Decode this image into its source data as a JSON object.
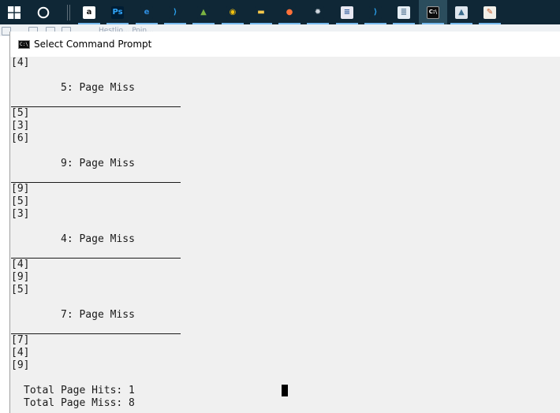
{
  "window": {
    "title": "Select Command Prompt"
  },
  "background": {
    "obscured_text": "Hestlio... Poin..."
  },
  "taskbar": {
    "apps": [
      {
        "name": "amazon",
        "glyph": "a",
        "color": "#ffffff",
        "fg": "#111111"
      },
      {
        "name": "photoshop",
        "glyph": "Ps",
        "color": "#001d34",
        "fg": "#31a8ff"
      },
      {
        "name": "edge",
        "glyph": "e",
        "color": "#0f2736",
        "fg": "#2f8ee0"
      },
      {
        "name": "vscode",
        "glyph": "⟩",
        "color": "#0f2736",
        "fg": "#2aa4f2"
      },
      {
        "name": "android-studio",
        "glyph": "▲",
        "color": "#0f2736",
        "fg": "#7cb342"
      },
      {
        "name": "chrome",
        "glyph": "◉",
        "color": "#0f2736",
        "fg": "#f4c20d"
      },
      {
        "name": "file-explorer",
        "glyph": "▬",
        "color": "#0f2736",
        "fg": "#f8c84a"
      },
      {
        "name": "firefox",
        "glyph": "●",
        "color": "#0f2736",
        "fg": "#ff7139"
      },
      {
        "name": "settings",
        "glyph": "✹",
        "color": "#0f2736",
        "fg": "#cfd6de"
      },
      {
        "name": "word-doc",
        "glyph": "≡",
        "color": "#e8e8f2",
        "fg": "#2b579a"
      },
      {
        "name": "vscode-2",
        "glyph": "⟩",
        "color": "#0f2736",
        "fg": "#2aa4f2"
      },
      {
        "name": "notepad",
        "glyph": "≣",
        "color": "#e6eef5",
        "fg": "#5a7a96"
      },
      {
        "name": "command-prompt",
        "glyph": "C:\\",
        "color": "#0c0c0c",
        "fg": "#ffffff",
        "active": true
      },
      {
        "name": "photos",
        "glyph": "▲",
        "color": "#dfe6ee",
        "fg": "#3c6d8e"
      },
      {
        "name": "paint",
        "glyph": "✎",
        "color": "#f1efe8",
        "fg": "#c85a2a"
      }
    ]
  },
  "console": {
    "sections": [
      {
        "type": "line",
        "text": "[4]"
      },
      {
        "type": "blank"
      },
      {
        "type": "header",
        "text": "5: Page Miss"
      },
      {
        "type": "sep"
      },
      {
        "type": "line",
        "text": "[5]"
      },
      {
        "type": "line",
        "text": "[3]"
      },
      {
        "type": "line",
        "text": "[6]"
      },
      {
        "type": "blank"
      },
      {
        "type": "header",
        "text": "9: Page Miss"
      },
      {
        "type": "sep"
      },
      {
        "type": "line",
        "text": "[9]"
      },
      {
        "type": "line",
        "text": "[5]"
      },
      {
        "type": "line",
        "text": "[3]"
      },
      {
        "type": "blank"
      },
      {
        "type": "header",
        "text": "4: Page Miss"
      },
      {
        "type": "sep"
      },
      {
        "type": "line",
        "text": "[4]"
      },
      {
        "type": "line",
        "text": "[9]"
      },
      {
        "type": "line",
        "text": "[5]"
      },
      {
        "type": "blank"
      },
      {
        "type": "header",
        "text": "7: Page Miss"
      },
      {
        "type": "sep"
      },
      {
        "type": "line",
        "text": "[7]"
      },
      {
        "type": "line",
        "text": "[4]"
      },
      {
        "type": "line",
        "text": "[9]"
      },
      {
        "type": "blank"
      },
      {
        "type": "total",
        "text": "Total Page Hits: 1"
      },
      {
        "type": "total",
        "text": "Total Page Miss: 8"
      }
    ]
  }
}
